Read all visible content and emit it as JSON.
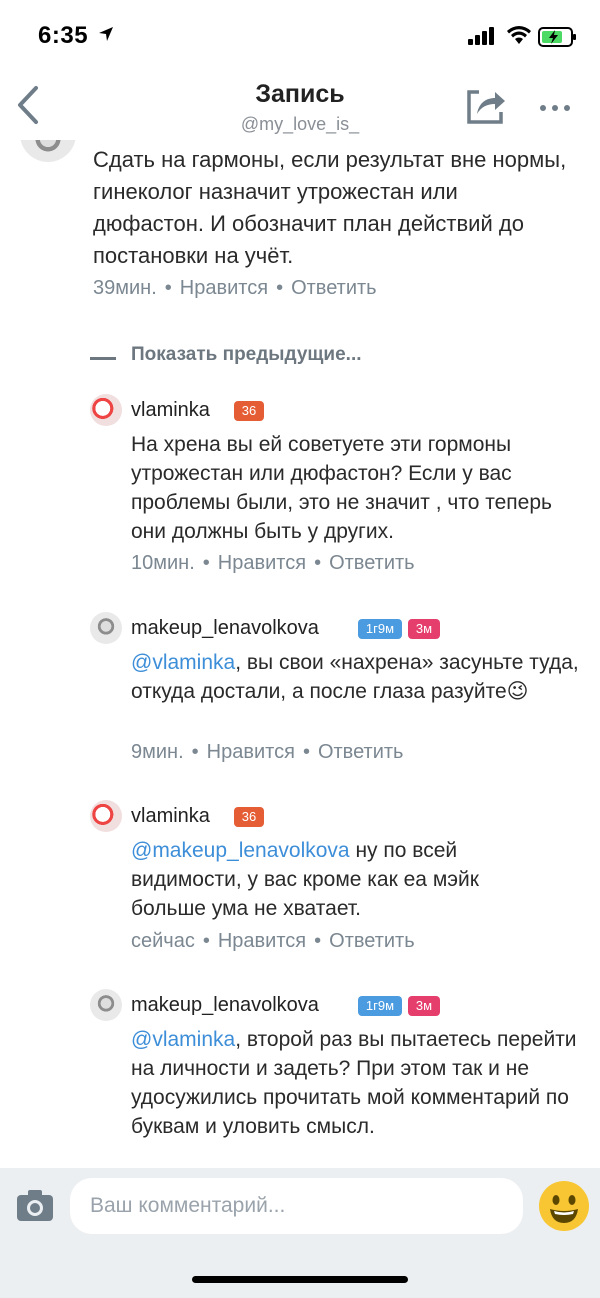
{
  "status_bar": {
    "time": "6:35"
  },
  "nav": {
    "title": "Запись",
    "subtitle": "@my_love_is_"
  },
  "first_comment": {
    "text": "Сдать на гармоны, если результат вне нормы, гинеколог назначит утрожестан или дюфастон. И обозначит план действий до постановки на учёт.",
    "time": "39мин.",
    "like_label": "Нравится",
    "reply_label": "Ответить"
  },
  "show_previous_label": "Показать предыдущие...",
  "comments": [
    {
      "user": "vlaminka",
      "badges": [
        "36"
      ],
      "text": "На хрена вы ей советуете эти гормоны утрожестан или дюфастон? Если у вас проблемы были, это не значит , что теперь они должны быть у других.",
      "time": "10мин.",
      "like_label": "Нравится",
      "reply_label": "Ответить"
    },
    {
      "user": "makeup_lenavolkova",
      "badges": [
        "1г9м",
        "3м"
      ],
      "mention": "@vlaminka",
      "text": ", вы свои «нахрена» засуньте туда, откуда достали, а после глаза разуйте😉",
      "time": "9мин.",
      "like_label": "Нравится",
      "reply_label": "Ответить"
    },
    {
      "user": "vlaminka",
      "badges": [
        "36"
      ],
      "mention": "@makeup_lenavolkova",
      "text": " ну по всей видимости, у вас кроме как еа мэйк больше ума не хватает.",
      "time": "сейчас",
      "like_label": "Нравится",
      "reply_label": "Ответить"
    },
    {
      "user": "makeup_lenavolkova",
      "badges": [
        "1г9м",
        "3м"
      ],
      "mention": "@vlaminka",
      "text": ", второй раз вы пытаетесь перейти на личности и задеть? При этом так и не удосужились прочитать мой комментарий по буквам и уловить смысл."
    }
  ],
  "input": {
    "placeholder": "Ваш комментарий..."
  },
  "colors": {
    "accent": "#3d8ed8",
    "meta": "#7b8791",
    "badge_orange": "#e55d35",
    "badge_blue": "#4b9be0",
    "badge_pink": "#e53d6c"
  },
  "icons": [
    "location-arrow-icon",
    "signal-icon",
    "wifi-icon",
    "battery-icon",
    "back-icon",
    "share-icon",
    "more-icon",
    "camera-icon",
    "emoji-icon"
  ]
}
